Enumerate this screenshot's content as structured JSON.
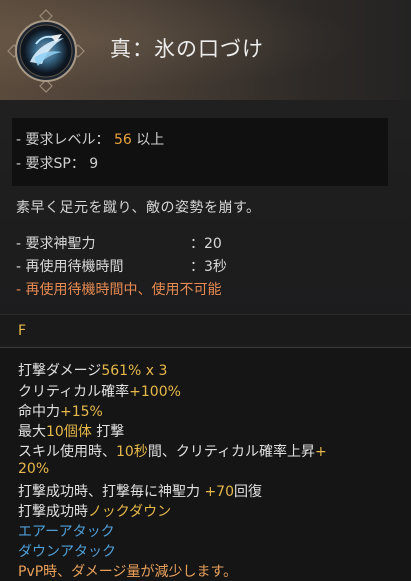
{
  "skill": {
    "title": "真：氷の口づけ",
    "icon": "ice-swirl-icon"
  },
  "requirements": {
    "level_label": "- 要求レベル：",
    "level_value": "56",
    "level_suffix": "以上",
    "sp_label": "- 要求SP：",
    "sp_value": "9"
  },
  "description": "素早く足元を蹴り、敵の姿勢を崩す。",
  "stats": {
    "holy_label": "- 要求神聖力",
    "holy_value": "：20",
    "cooldown_label": "- 再使用待機時間",
    "cooldown_value": "：3秒",
    "cooldown_warning": "- 再使用待機時間中、使用不可能"
  },
  "key": {
    "label": "F"
  },
  "details": {
    "l1_text": "打撃ダメージ",
    "l1_val": "561% x 3",
    "l2_text": "クリティカル確率",
    "l2_val": "+100%",
    "l3_text": "命中力",
    "l3_val": "+15%",
    "l4_text": "最大",
    "l4_val": "10個体",
    "l4_tail": " 打撃",
    "l5_text": "スキル使用時、",
    "l5_val": "10秒",
    "l5_mid": "間、クリティカル確率上昇",
    "l5_val2": "+",
    "l6_val": "20%",
    "l7_text": "打撃成功時、打撃毎に神聖力 ",
    "l7_val": "+70",
    "l7_tail": "回復",
    "l8_text": "打撃成功時",
    "l8_val": "ノックダウン",
    "l9_val": "エアーアタック",
    "l10_val": "ダウンアタック",
    "l11_text": "PvP時、ダメージ量が減少します。"
  },
  "colors": {
    "highlight_yellow": "#e6b84a",
    "highlight_blue": "#4f9fd8",
    "warning_orange": "#e58a52"
  }
}
